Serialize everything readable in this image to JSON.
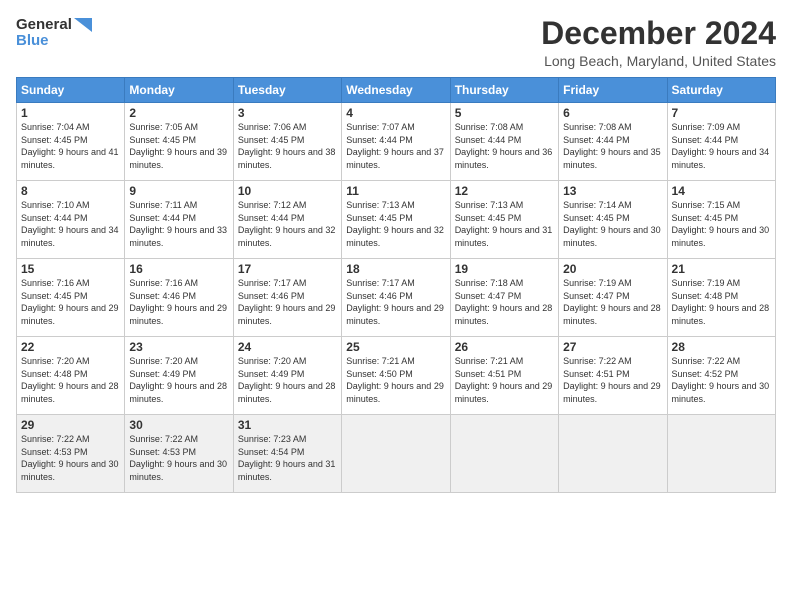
{
  "logo": {
    "line1": "General",
    "line2": "Blue"
  },
  "title": "December 2024",
  "location": "Long Beach, Maryland, United States",
  "headers": [
    "Sunday",
    "Monday",
    "Tuesday",
    "Wednesday",
    "Thursday",
    "Friday",
    "Saturday"
  ],
  "weeks": [
    [
      {
        "day": "1",
        "sunrise": "7:04 AM",
        "sunset": "4:45 PM",
        "daylight": "9 hours and 41 minutes."
      },
      {
        "day": "2",
        "sunrise": "7:05 AM",
        "sunset": "4:45 PM",
        "daylight": "9 hours and 39 minutes."
      },
      {
        "day": "3",
        "sunrise": "7:06 AM",
        "sunset": "4:45 PM",
        "daylight": "9 hours and 38 minutes."
      },
      {
        "day": "4",
        "sunrise": "7:07 AM",
        "sunset": "4:44 PM",
        "daylight": "9 hours and 37 minutes."
      },
      {
        "day": "5",
        "sunrise": "7:08 AM",
        "sunset": "4:44 PM",
        "daylight": "9 hours and 36 minutes."
      },
      {
        "day": "6",
        "sunrise": "7:08 AM",
        "sunset": "4:44 PM",
        "daylight": "9 hours and 35 minutes."
      },
      {
        "day": "7",
        "sunrise": "7:09 AM",
        "sunset": "4:44 PM",
        "daylight": "9 hours and 34 minutes."
      }
    ],
    [
      {
        "day": "8",
        "sunrise": "7:10 AM",
        "sunset": "4:44 PM",
        "daylight": "9 hours and 34 minutes."
      },
      {
        "day": "9",
        "sunrise": "7:11 AM",
        "sunset": "4:44 PM",
        "daylight": "9 hours and 33 minutes."
      },
      {
        "day": "10",
        "sunrise": "7:12 AM",
        "sunset": "4:44 PM",
        "daylight": "9 hours and 32 minutes."
      },
      {
        "day": "11",
        "sunrise": "7:13 AM",
        "sunset": "4:45 PM",
        "daylight": "9 hours and 32 minutes."
      },
      {
        "day": "12",
        "sunrise": "7:13 AM",
        "sunset": "4:45 PM",
        "daylight": "9 hours and 31 minutes."
      },
      {
        "day": "13",
        "sunrise": "7:14 AM",
        "sunset": "4:45 PM",
        "daylight": "9 hours and 30 minutes."
      },
      {
        "day": "14",
        "sunrise": "7:15 AM",
        "sunset": "4:45 PM",
        "daylight": "9 hours and 30 minutes."
      }
    ],
    [
      {
        "day": "15",
        "sunrise": "7:16 AM",
        "sunset": "4:45 PM",
        "daylight": "9 hours and 29 minutes."
      },
      {
        "day": "16",
        "sunrise": "7:16 AM",
        "sunset": "4:46 PM",
        "daylight": "9 hours and 29 minutes."
      },
      {
        "day": "17",
        "sunrise": "7:17 AM",
        "sunset": "4:46 PM",
        "daylight": "9 hours and 29 minutes."
      },
      {
        "day": "18",
        "sunrise": "7:17 AM",
        "sunset": "4:46 PM",
        "daylight": "9 hours and 29 minutes."
      },
      {
        "day": "19",
        "sunrise": "7:18 AM",
        "sunset": "4:47 PM",
        "daylight": "9 hours and 28 minutes."
      },
      {
        "day": "20",
        "sunrise": "7:19 AM",
        "sunset": "4:47 PM",
        "daylight": "9 hours and 28 minutes."
      },
      {
        "day": "21",
        "sunrise": "7:19 AM",
        "sunset": "4:48 PM",
        "daylight": "9 hours and 28 minutes."
      }
    ],
    [
      {
        "day": "22",
        "sunrise": "7:20 AM",
        "sunset": "4:48 PM",
        "daylight": "9 hours and 28 minutes."
      },
      {
        "day": "23",
        "sunrise": "7:20 AM",
        "sunset": "4:49 PM",
        "daylight": "9 hours and 28 minutes."
      },
      {
        "day": "24",
        "sunrise": "7:20 AM",
        "sunset": "4:49 PM",
        "daylight": "9 hours and 28 minutes."
      },
      {
        "day": "25",
        "sunrise": "7:21 AM",
        "sunset": "4:50 PM",
        "daylight": "9 hours and 29 minutes."
      },
      {
        "day": "26",
        "sunrise": "7:21 AM",
        "sunset": "4:51 PM",
        "daylight": "9 hours and 29 minutes."
      },
      {
        "day": "27",
        "sunrise": "7:22 AM",
        "sunset": "4:51 PM",
        "daylight": "9 hours and 29 minutes."
      },
      {
        "day": "28",
        "sunrise": "7:22 AM",
        "sunset": "4:52 PM",
        "daylight": "9 hours and 30 minutes."
      }
    ],
    [
      {
        "day": "29",
        "sunrise": "7:22 AM",
        "sunset": "4:53 PM",
        "daylight": "9 hours and 30 minutes."
      },
      {
        "day": "30",
        "sunrise": "7:22 AM",
        "sunset": "4:53 PM",
        "daylight": "9 hours and 30 minutes."
      },
      {
        "day": "31",
        "sunrise": "7:23 AM",
        "sunset": "4:54 PM",
        "daylight": "9 hours and 31 minutes."
      },
      null,
      null,
      null,
      null
    ]
  ]
}
